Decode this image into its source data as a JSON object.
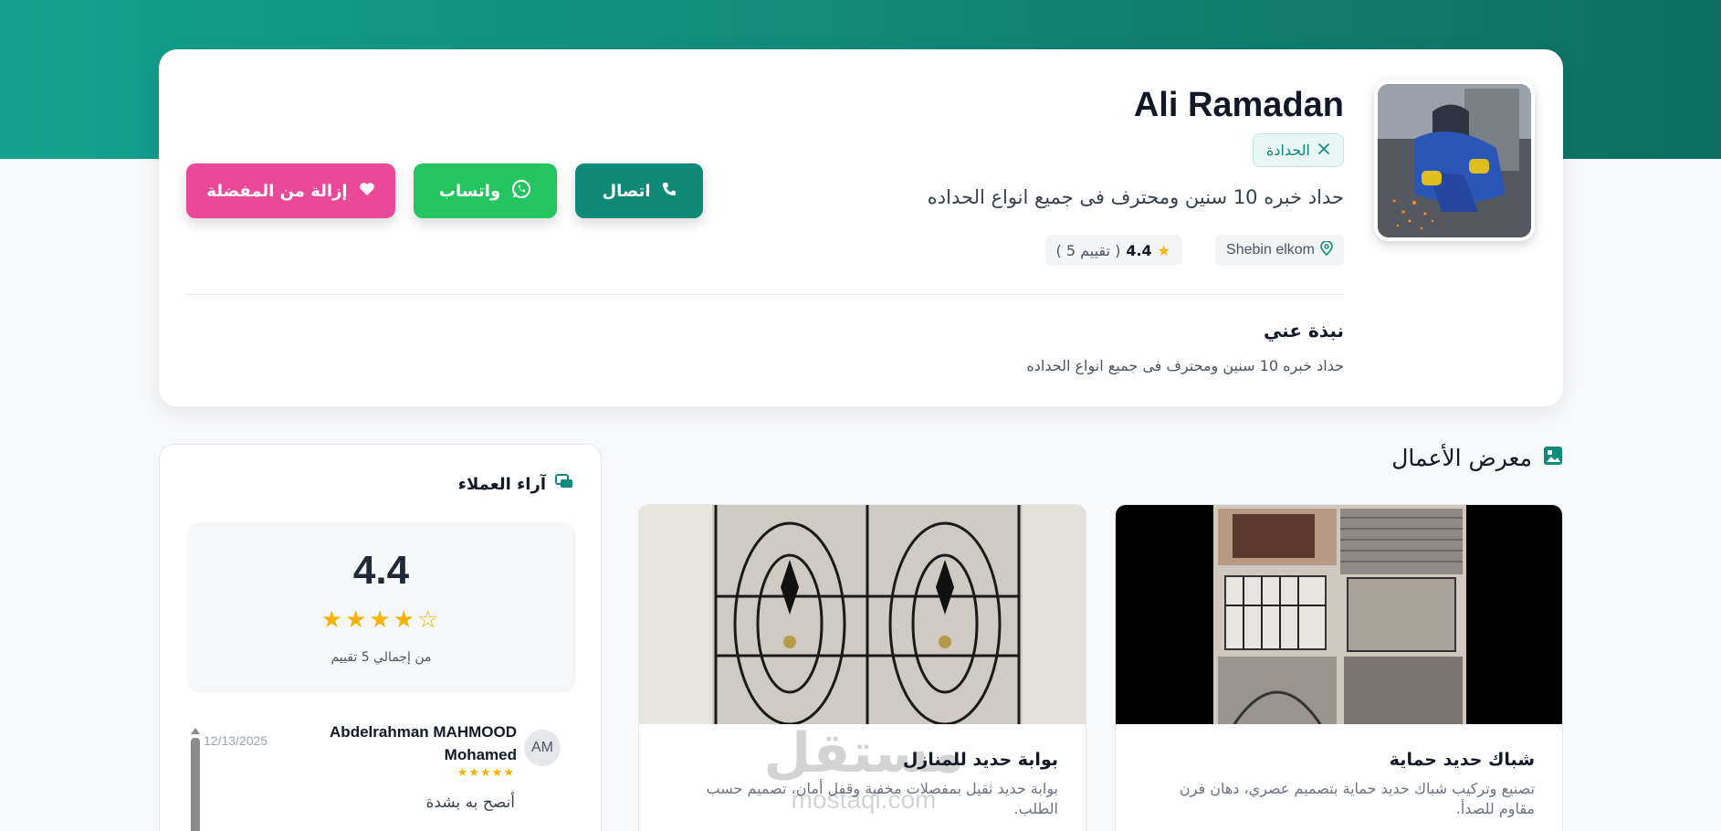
{
  "profile": {
    "name": "Ali Ramadan",
    "craft": "الحدادة",
    "headline": "حداد خبره 10 سنين ومحترف فى جميع انواع الحداده",
    "location": "Shebin elkom",
    "rating": "4.4",
    "rating_count": "( 5 تقييم )",
    "about_title": "نبذة عني",
    "about_text": "حداد خبره 10 سنين ومحترف فى جميع انواع الحداده"
  },
  "actions": {
    "call_label": "اتصال",
    "whatsapp_label": "واتساب",
    "favorite_label": "إزالة من المفضلة"
  },
  "portfolio": {
    "title": "معرض الأعمال",
    "items": [
      {
        "title": "شباك حديد حماية",
        "description": "تصنيع وتركيب شباك حديد حماية بتصميم عصري، دهان فرن مقاوم للصدأ."
      },
      {
        "title": "بوابة حديد للمنازل",
        "description": "بوابة حديد ثقيل بمفصلات مخفية وقفل أمان، تصميم حسب الطلب."
      }
    ]
  },
  "reviews": {
    "title": "آراء العملاء",
    "average": "4.4",
    "stars": "★★★★☆",
    "total": "من إجمالي 5 تقييم",
    "items": [
      {
        "initials": "AM",
        "name": "Abdelrahman MAHMOOD Mohamed",
        "date": "12/13/2025",
        "stars": "★★★★★",
        "text": "أنصح به بشدة"
      }
    ]
  },
  "watermark": {
    "arabic": "مستقل",
    "latin": "mostaql.com"
  },
  "colors": {
    "primary": "#0f8a79",
    "whatsapp": "#22c55e",
    "favorite": "#ec4899",
    "star": "#f5b301"
  }
}
